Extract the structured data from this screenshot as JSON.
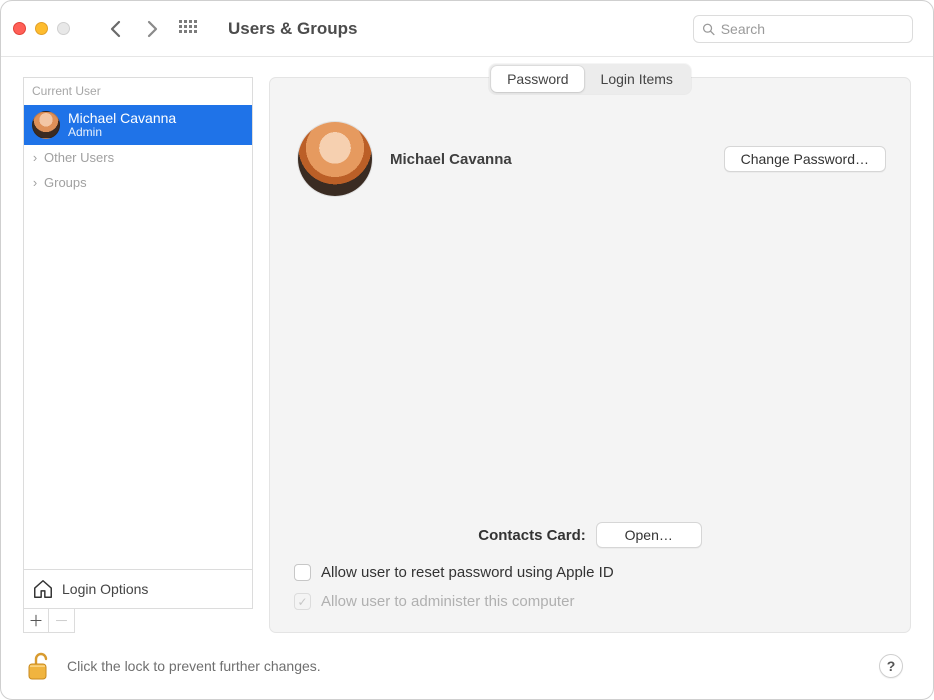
{
  "window": {
    "title": "Users & Groups",
    "search_placeholder": "Search"
  },
  "sidebar": {
    "header": "Current User",
    "user": {
      "name": "Michael Cavanna",
      "role": "Admin"
    },
    "groups": [
      {
        "label": "Other Users"
      },
      {
        "label": "Groups"
      }
    ],
    "login_options_label": "Login Options"
  },
  "detail": {
    "tabs": {
      "password": "Password",
      "login_items": "Login Items"
    },
    "display_name": "Michael Cavanna",
    "change_password_label": "Change Password…",
    "contacts_label": "Contacts Card:",
    "open_label": "Open…",
    "allow_reset_label": "Allow user to reset password using Apple ID",
    "allow_admin_label": "Allow user to administer this computer"
  },
  "footer": {
    "lock_text": "Click the lock to prevent further changes.",
    "help_label": "?"
  }
}
